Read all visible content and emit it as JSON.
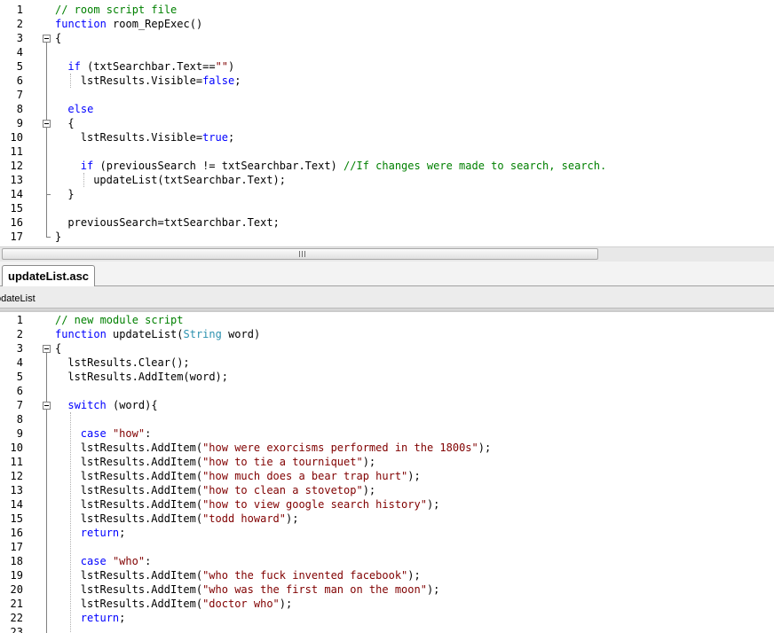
{
  "top_editor": {
    "lines": [
      {
        "n": "1",
        "indent": 0,
        "tokens": [
          {
            "t": "// room script file",
            "c": "cm"
          }
        ]
      },
      {
        "n": "2",
        "indent": 0,
        "tokens": [
          {
            "t": "function",
            "c": "kw"
          },
          {
            "t": " room_RepExec()",
            "c": ""
          }
        ]
      },
      {
        "n": "3",
        "indent": 0,
        "tokens": [
          {
            "t": "{",
            "c": ""
          }
        ]
      },
      {
        "n": "4",
        "indent": 0,
        "tokens": []
      },
      {
        "n": "5",
        "indent": 2,
        "tokens": [
          {
            "t": "if",
            "c": "kw"
          },
          {
            "t": " (txtSearchbar.Text==",
            "c": ""
          },
          {
            "t": "\"\"",
            "c": "st"
          },
          {
            "t": ")",
            "c": ""
          }
        ]
      },
      {
        "n": "6",
        "indent": 4,
        "tokens": [
          {
            "t": "lstResults.Visible=",
            "c": ""
          },
          {
            "t": "false",
            "c": "kw"
          },
          {
            "t": ";",
            "c": ""
          }
        ]
      },
      {
        "n": "7",
        "indent": 0,
        "tokens": []
      },
      {
        "n": "8",
        "indent": 2,
        "tokens": [
          {
            "t": "else",
            "c": "kw"
          }
        ]
      },
      {
        "n": "9",
        "indent": 2,
        "tokens": [
          {
            "t": "{",
            "c": ""
          }
        ]
      },
      {
        "n": "10",
        "indent": 4,
        "tokens": [
          {
            "t": "lstResults.Visible=",
            "c": ""
          },
          {
            "t": "true",
            "c": "kw"
          },
          {
            "t": ";",
            "c": ""
          }
        ]
      },
      {
        "n": "11",
        "indent": 0,
        "tokens": []
      },
      {
        "n": "12",
        "indent": 4,
        "tokens": [
          {
            "t": "if",
            "c": "kw"
          },
          {
            "t": " (previousSearch != txtSearchbar.Text) ",
            "c": ""
          },
          {
            "t": "//If changes were made to search, search.",
            "c": "cm"
          }
        ]
      },
      {
        "n": "13",
        "indent": 6,
        "tokens": [
          {
            "t": "updateList(txtSearchbar.Text);",
            "c": ""
          }
        ]
      },
      {
        "n": "14",
        "indent": 2,
        "tokens": [
          {
            "t": "}",
            "c": ""
          }
        ]
      },
      {
        "n": "15",
        "indent": 0,
        "tokens": []
      },
      {
        "n": "16",
        "indent": 2,
        "tokens": [
          {
            "t": "previousSearch=txtSearchbar.Text;",
            "c": ""
          }
        ]
      },
      {
        "n": "17",
        "indent": 0,
        "tokens": [
          {
            "t": "}",
            "c": ""
          }
        ]
      }
    ]
  },
  "scrollbar": {
    "grip_icon": "grip-lines-icon"
  },
  "tab": {
    "label": "updateList.asc"
  },
  "function_bar": {
    "label": "pdateList"
  },
  "bottom_editor": {
    "lines": [
      {
        "n": "1",
        "indent": 0,
        "tokens": [
          {
            "t": "// new module script",
            "c": "cm"
          }
        ]
      },
      {
        "n": "2",
        "indent": 0,
        "tokens": [
          {
            "t": "function",
            "c": "kw"
          },
          {
            "t": " updateList(",
            "c": ""
          },
          {
            "t": "String",
            "c": "ty"
          },
          {
            "t": " word)",
            "c": ""
          }
        ]
      },
      {
        "n": "3",
        "indent": 0,
        "tokens": [
          {
            "t": "{",
            "c": ""
          }
        ]
      },
      {
        "n": "4",
        "indent": 2,
        "tokens": [
          {
            "t": "lstResults.Clear();",
            "c": ""
          }
        ]
      },
      {
        "n": "5",
        "indent": 2,
        "tokens": [
          {
            "t": "lstResults.AddItem(word);",
            "c": ""
          }
        ]
      },
      {
        "n": "6",
        "indent": 0,
        "tokens": []
      },
      {
        "n": "7",
        "indent": 2,
        "tokens": [
          {
            "t": "switch",
            "c": "kw"
          },
          {
            "t": " (word){",
            "c": ""
          }
        ]
      },
      {
        "n": "8",
        "indent": 0,
        "tokens": []
      },
      {
        "n": "9",
        "indent": 4,
        "tokens": [
          {
            "t": "case",
            "c": "kw"
          },
          {
            "t": " ",
            "c": ""
          },
          {
            "t": "\"how\"",
            "c": "st"
          },
          {
            "t": ":",
            "c": ""
          }
        ]
      },
      {
        "n": "10",
        "indent": 4,
        "tokens": [
          {
            "t": "lstResults.AddItem(",
            "c": ""
          },
          {
            "t": "\"how were exorcisms performed in the 1800s\"",
            "c": "st"
          },
          {
            "t": ");",
            "c": ""
          }
        ]
      },
      {
        "n": "11",
        "indent": 4,
        "tokens": [
          {
            "t": "lstResults.AddItem(",
            "c": ""
          },
          {
            "t": "\"how to tie a tourniquet\"",
            "c": "st"
          },
          {
            "t": ");",
            "c": ""
          }
        ]
      },
      {
        "n": "12",
        "indent": 4,
        "tokens": [
          {
            "t": "lstResults.AddItem(",
            "c": ""
          },
          {
            "t": "\"how much does a bear trap hurt\"",
            "c": "st"
          },
          {
            "t": ");",
            "c": ""
          }
        ]
      },
      {
        "n": "13",
        "indent": 4,
        "tokens": [
          {
            "t": "lstResults.AddItem(",
            "c": ""
          },
          {
            "t": "\"how to clean a stovetop\"",
            "c": "st"
          },
          {
            "t": ");",
            "c": ""
          }
        ]
      },
      {
        "n": "14",
        "indent": 4,
        "tokens": [
          {
            "t": "lstResults.AddItem(",
            "c": ""
          },
          {
            "t": "\"how to view google search history\"",
            "c": "st"
          },
          {
            "t": ");",
            "c": ""
          }
        ]
      },
      {
        "n": "15",
        "indent": 4,
        "tokens": [
          {
            "t": "lstResults.AddItem(",
            "c": ""
          },
          {
            "t": "\"todd howard\"",
            "c": "st"
          },
          {
            "t": ");",
            "c": ""
          }
        ]
      },
      {
        "n": "16",
        "indent": 4,
        "tokens": [
          {
            "t": "return",
            "c": "kw"
          },
          {
            "t": ";",
            "c": ""
          }
        ]
      },
      {
        "n": "17",
        "indent": 0,
        "tokens": []
      },
      {
        "n": "18",
        "indent": 4,
        "tokens": [
          {
            "t": "case",
            "c": "kw"
          },
          {
            "t": " ",
            "c": ""
          },
          {
            "t": "\"who\"",
            "c": "st"
          },
          {
            "t": ":",
            "c": ""
          }
        ]
      },
      {
        "n": "19",
        "indent": 4,
        "tokens": [
          {
            "t": "lstResults.AddItem(",
            "c": ""
          },
          {
            "t": "\"who the fuck invented facebook\"",
            "c": "st"
          },
          {
            "t": ");",
            "c": ""
          }
        ]
      },
      {
        "n": "20",
        "indent": 4,
        "tokens": [
          {
            "t": "lstResults.AddItem(",
            "c": ""
          },
          {
            "t": "\"who was the first man on the moon\"",
            "c": "st"
          },
          {
            "t": ");",
            "c": ""
          }
        ]
      },
      {
        "n": "21",
        "indent": 4,
        "tokens": [
          {
            "t": "lstResults.AddItem(",
            "c": ""
          },
          {
            "t": "\"doctor who\"",
            "c": "st"
          },
          {
            "t": ");",
            "c": ""
          }
        ]
      },
      {
        "n": "22",
        "indent": 4,
        "tokens": [
          {
            "t": "return",
            "c": "kw"
          },
          {
            "t": ";",
            "c": ""
          }
        ]
      },
      {
        "n": "23",
        "indent": 0,
        "tokens": []
      }
    ]
  },
  "colors": {
    "keyword": "#0000ff",
    "comment": "#008000",
    "string": "#800000",
    "type": "#2b91af",
    "default": "#000000"
  }
}
